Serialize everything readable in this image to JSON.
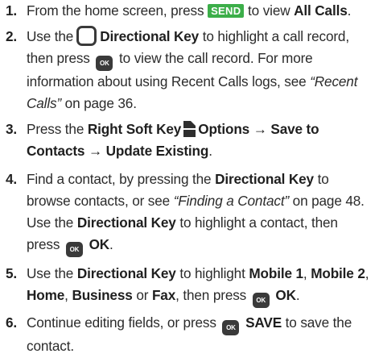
{
  "steps": [
    {
      "number": "1.",
      "parts": {
        "a": "From the home screen, press",
        "key": "SEND",
        "b": "to view",
        "bold1": "All Calls",
        "c": "."
      }
    },
    {
      "number": "2.",
      "parts": {
        "a": "Use the",
        "bold1": "Directional Key",
        "b": "to highlight a call record, then press",
        "key": "OK",
        "c": "to view the call record. For more information about using Recent Calls logs, see",
        "ital1": "“Recent Calls”",
        "d": "on page 36."
      }
    },
    {
      "number": "3.",
      "parts": {
        "a": "Press the",
        "bold1": "Right Soft Key",
        "bold2": "Options → Save to Contacts → Update Existing",
        "b": "."
      }
    },
    {
      "number": "4.",
      "parts": {
        "a": "Find a contact, by pressing the",
        "bold1": "Directional Key",
        "b": "to browse contacts, or see",
        "ital1": "“Finding a Contact”",
        "c": "on page 48. Use the",
        "bold2": "Directional Key",
        "d": "to highlight a contact, then press",
        "key": "OK",
        "bold3": "OK",
        "e": "."
      }
    },
    {
      "number": "5.",
      "parts": {
        "a": "Use the",
        "bold1": "Directional Key",
        "b": "to highlight",
        "bold2": "Mobile 1",
        "c": ",",
        "bold3": "Mobile 2",
        "d": ",",
        "bold4": "Home",
        "e": ",",
        "bold5": "Business",
        "f": "or",
        "bold6": "Fax",
        "g": ", then press",
        "key": "OK",
        "bold7": "OK",
        "h": "."
      }
    },
    {
      "number": "6.",
      "parts": {
        "a": "Continue editing fields, or press",
        "key": "OK",
        "bold1": "SAVE",
        "b": "to save the contact."
      }
    }
  ],
  "icons": {
    "send_key_color": "#3cae49",
    "ok_key_color": "#3a3a3a",
    "directional_key": "directional-key-icon",
    "right_soft_key": "right-soft-key-icon"
  }
}
